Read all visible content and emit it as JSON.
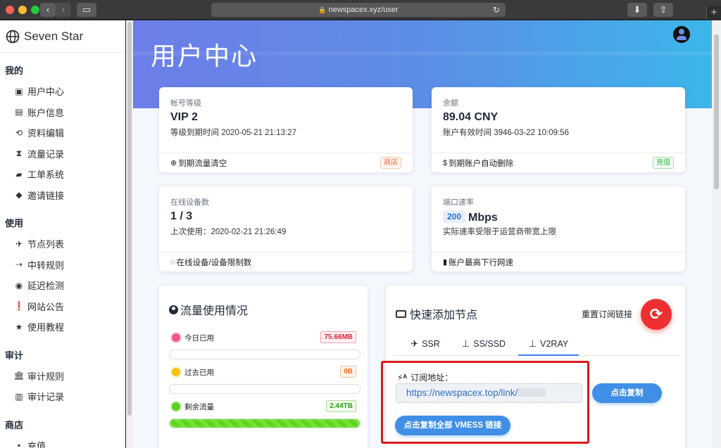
{
  "browser": {
    "url": "newspacex.xyz/user"
  },
  "sidebar": {
    "brand": "Seven Star",
    "sections": [
      {
        "title": "我的",
        "items": [
          "用户中心",
          "账户信息",
          "资料编辑",
          "流量记录",
          "工单系统",
          "邀请链接"
        ]
      },
      {
        "title": "使用",
        "items": [
          "节点列表",
          "中转规则",
          "延迟检测",
          "网站公告",
          "使用教程"
        ]
      },
      {
        "title": "审计",
        "items": [
          "审计规则",
          "审计记录"
        ]
      },
      {
        "title": "商店",
        "items": [
          "充值"
        ]
      }
    ]
  },
  "header": {
    "title": "用户中心"
  },
  "cards": {
    "level": {
      "label": "帐号等级",
      "value": "VIP 2",
      "sub": "等级到期时间 2020-05-21 21:13:27",
      "foot": "到期流量清空",
      "badge": "商店"
    },
    "balance": {
      "label": "余额",
      "value": "89.04 CNY",
      "sub": "账户有效时间 3946-03-22 10:09:56",
      "foot": "到期账户自动删除",
      "badge": "充值"
    },
    "devices": {
      "label": "在线设备数",
      "value": "1 / 3",
      "sub": "上次使用：2020-02-21 21:26:49",
      "foot": "在线设备/设备限制数"
    },
    "speed": {
      "label": "端口速率",
      "value_num": "200",
      "value_unit": "Mbps",
      "sub": "实际速率受限于运营商带宽上限",
      "foot": "账户最高下行网速"
    }
  },
  "traffic": {
    "title": "流量使用情况",
    "rows": [
      {
        "label": "今日已用",
        "value": "75.66MB",
        "fill": 0.0
      },
      {
        "label": "过去已用",
        "value": "0B",
        "fill": 0.0
      },
      {
        "label": "剩余流量",
        "value": "2.44TB",
        "fill": 1.0
      }
    ]
  },
  "quickadd": {
    "title": "快速添加节点",
    "reset_label": "重置订阅链接",
    "tabs": [
      "SSR",
      "SS/SSD",
      "V2RAY"
    ],
    "active_tab": "V2RAY",
    "sub_label": "订阅地址：",
    "sub_url": "https://newspacex.top/link/",
    "copy_button": "点击复制",
    "copy_all_button": "点击复制全部 VMESS 链接"
  }
}
